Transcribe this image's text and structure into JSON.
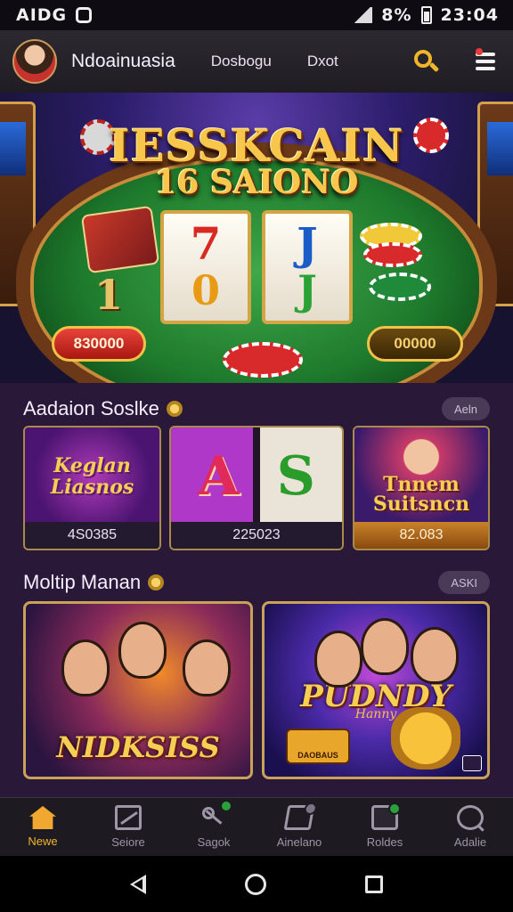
{
  "status_bar": {
    "left_text": "AIDG",
    "right_text": "8%",
    "time": "23:04",
    "icons": [
      "square-icon",
      "signal-icon",
      "bluetooth-icon",
      "alarm-icon",
      "wifi-icon",
      "battery-icon"
    ]
  },
  "header": {
    "brand": "Ndoainuasia",
    "nav": [
      "Dosbogu",
      "Dxot"
    ],
    "icons": [
      "avatar",
      "search-icon",
      "menu-icon"
    ],
    "accent": "#f0b52a"
  },
  "hero": {
    "title_line1": "IESSKCAIN",
    "title_line2": "16 SAIONO",
    "reel1": {
      "top": "7",
      "bottom": "0"
    },
    "reel2": {
      "top": "J",
      "bottom": "J"
    },
    "left_number": "1",
    "left_button": "830000",
    "right_button": "00000"
  },
  "section1": {
    "title": "Aadaion Soslke",
    "more": "Aeln",
    "tiles": [
      {
        "art": "Keglan Liasnos",
        "value": "4S0385"
      },
      {
        "art_left": "A",
        "art_right": "S",
        "value": "225023"
      },
      {
        "art": "Tnnem Suitsncn",
        "value": "82.083"
      }
    ]
  },
  "section2": {
    "title": "Moltip Manan",
    "more": "ASKI",
    "tiles": [
      {
        "label": "NIDKSISS"
      },
      {
        "label": "PUDNDY",
        "sub": "Hanny",
        "sign": "DAOBAUS"
      }
    ]
  },
  "bottom_nav": {
    "tabs": [
      {
        "label": "Newe",
        "icon": "home-icon",
        "active": true
      },
      {
        "label": "Seiore",
        "icon": "chart-box-icon"
      },
      {
        "label": "Sagok",
        "icon": "share-icon"
      },
      {
        "label": "Ainelano",
        "icon": "edit-icon"
      },
      {
        "label": "Roldes",
        "icon": "stack-icon"
      },
      {
        "label": "Adalie",
        "icon": "search-circle-icon"
      }
    ]
  },
  "system_nav": [
    "back-icon",
    "home-icon",
    "recents-icon"
  ]
}
